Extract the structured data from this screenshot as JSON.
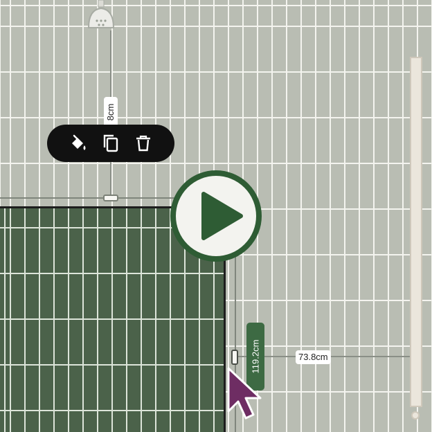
{
  "measurements": {
    "top_distance": "8cm",
    "panel_height": "119.2cm",
    "side_distance": "73.8cm"
  },
  "toolbar": {
    "items": [
      {
        "icon": "paint-bucket-icon",
        "action": "fill"
      },
      {
        "icon": "copy-icon",
        "action": "duplicate"
      },
      {
        "icon": "trash-icon",
        "action": "delete"
      }
    ]
  },
  "colors": {
    "wall_tile": "#b9bdb3",
    "grout": "#f4f4ef",
    "selected_tile": "#4b624a",
    "accent_green": "#2e5c34",
    "cursor": "#6e2d63",
    "toolbar": "#111111"
  }
}
